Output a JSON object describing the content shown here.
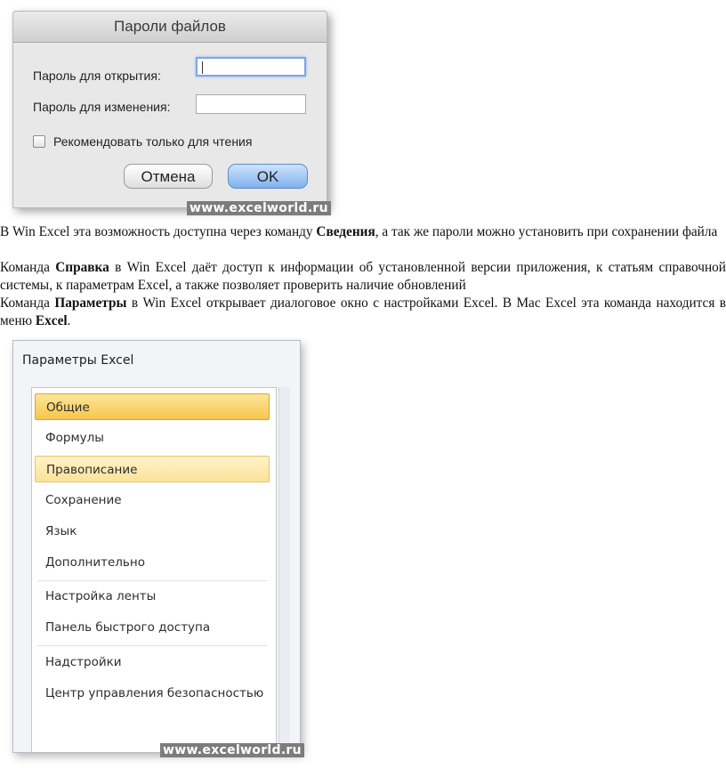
{
  "mac_dialog": {
    "title": "Пароли файлов",
    "open_password_label": "Пароль для открытия:",
    "modify_password_label": "Пароль для изменения:",
    "readonly_label": "Рекомендовать только для чтения",
    "cancel_label": "Отмена",
    "ok_label": "OK",
    "watermark": "www.excelworld.ru"
  },
  "paragraphs": {
    "p1": {
      "a": "В Win Excel эта возможность доступна через команду ",
      "b": "Сведения",
      "c": ", а так же пароли можно установить при сохранении файла"
    },
    "p2": {
      "a": "Команда ",
      "b": "Справка",
      "c": " в Win Excel даёт доступ к информации об установленной версии приложения, к статьям справочной системы, к параметрам Excel, а также позволяет проверить наличие обновлений"
    },
    "p3": {
      "a": "Команда ",
      "b": "Параметры",
      "c": " в Win Excel открывает диалоговое окно с настройками Excel. В Mac Excel эта команда находится в меню ",
      "d": "Excel",
      "e": "."
    }
  },
  "excel_options": {
    "title": "Параметры Excel",
    "items": [
      "Общие",
      "Формулы",
      "Правописание",
      "Сохранение",
      "Язык",
      "Дополнительно",
      "Настройка ленты",
      "Панель быстрого доступа",
      "Надстройки",
      "Центр управления безопасностью"
    ],
    "watermark": "www.excelworld.ru"
  }
}
